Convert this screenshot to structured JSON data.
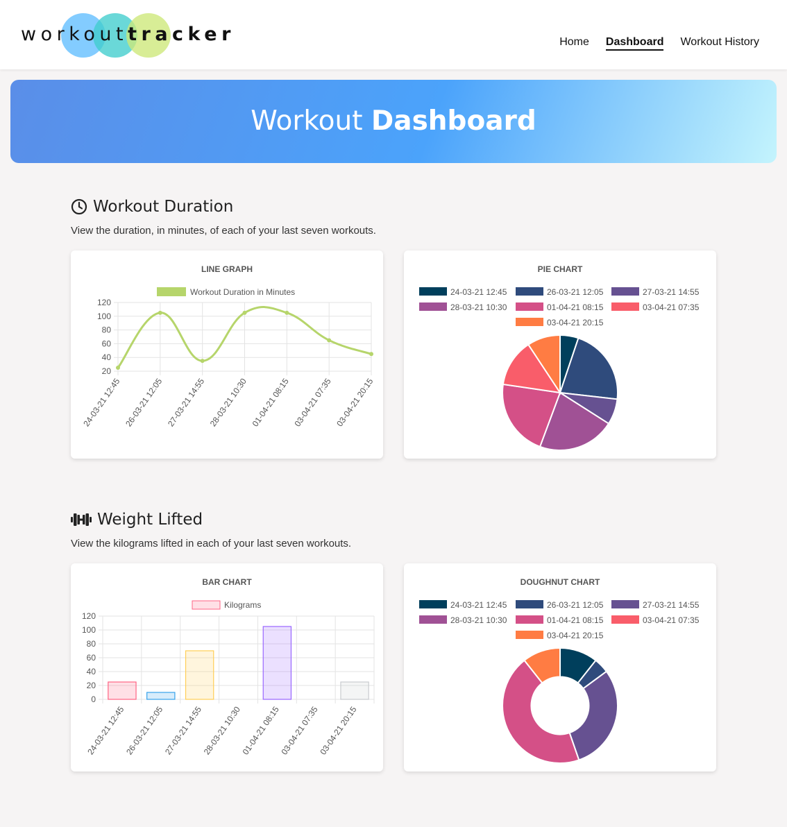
{
  "brand": {
    "light": "workout",
    "bold": "tracker"
  },
  "nav": {
    "items": [
      {
        "label": "Home",
        "active": false
      },
      {
        "label": "Dashboard",
        "active": true
      },
      {
        "label": "Workout History",
        "active": false
      }
    ]
  },
  "banner": {
    "light": "Workout ",
    "bold": "Dashboard"
  },
  "duration_section": {
    "title": "Workout Duration",
    "icon": "clock-icon",
    "description": "View the duration, in minutes, of each of your last seven workouts."
  },
  "weight_section": {
    "title": "Weight Lifted",
    "icon": "dumbbell-icon",
    "description": "View the kilograms lifted in each of your last seven workouts."
  },
  "colors": {
    "line": "#b6d56b",
    "palette": [
      "#003f5c",
      "#2f4b7c",
      "#665191",
      "#a05195",
      "#d45087",
      "#f95d6a",
      "#ff7c43"
    ]
  },
  "chart_data": [
    {
      "type": "line",
      "title": "LINE GRAPH",
      "categories": [
        "24-03-21 12:45",
        "26-03-21 12:05",
        "27-03-21 14:55",
        "28-03-21 10:30",
        "01-04-21 08:15",
        "03-04-21 07:35",
        "03-04-21 20:15"
      ],
      "series": [
        {
          "name": "Workout Duration in Minutes",
          "values": [
            25,
            105,
            35,
            105,
            105,
            65,
            45
          ]
        }
      ],
      "ylim": [
        20,
        120
      ],
      "yticks": [
        "20",
        "40",
        "60",
        "80",
        "100",
        "120"
      ],
      "legend": "top",
      "grid": true
    },
    {
      "type": "pie",
      "title": "PIE CHART",
      "categories": [
        "24-03-21 12:45",
        "26-03-21 12:05",
        "27-03-21 14:55",
        "28-03-21 10:30",
        "01-04-21 08:15",
        "03-04-21 07:35",
        "03-04-21 20:15"
      ],
      "values": [
        25,
        105,
        35,
        105,
        105,
        65,
        45
      ],
      "legend": "top"
    },
    {
      "type": "bar",
      "title": "BAR CHART",
      "categories": [
        "24-03-21 12:45",
        "26-03-21 12:05",
        "27-03-21 14:55",
        "28-03-21 10:30",
        "01-04-21 08:15",
        "03-04-21 07:35",
        "03-04-21 20:15"
      ],
      "series": [
        {
          "name": "Kilograms",
          "values": [
            25,
            10,
            70,
            0,
            105,
            0,
            25
          ]
        }
      ],
      "bar_colors": [
        "#ff6384",
        "#36a2eb",
        "#ffce56",
        "#4bc0c0",
        "#9966ff",
        "#ff9f40",
        "#c9cbcf"
      ],
      "ylim": [
        0,
        120
      ],
      "yticks": [
        "0",
        "20",
        "40",
        "60",
        "80",
        "100",
        "120"
      ],
      "legend": "top",
      "grid": true
    },
    {
      "type": "doughnut",
      "title": "DOUGHNUT CHART",
      "categories": [
        "24-03-21 12:45",
        "26-03-21 12:05",
        "27-03-21 14:55",
        "28-03-21 10:30",
        "01-04-21 08:15",
        "03-04-21 07:35",
        "03-04-21 20:15"
      ],
      "values": [
        25,
        10,
        70,
        0,
        105,
        0,
        25
      ],
      "legend": "top"
    }
  ]
}
